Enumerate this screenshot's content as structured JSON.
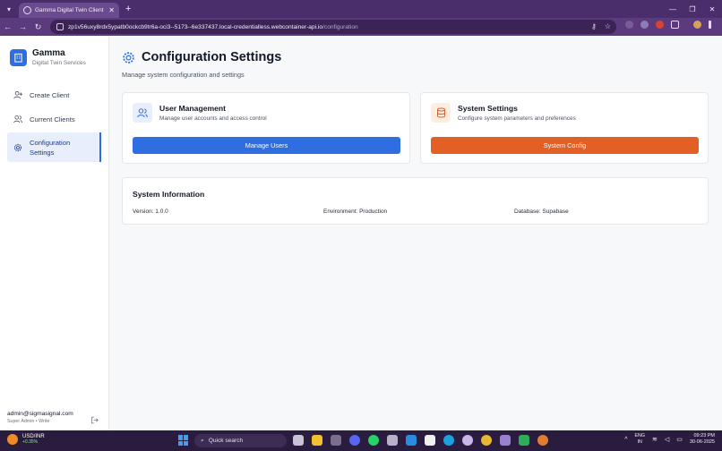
{
  "browser": {
    "tab_title": "Gamma Digital Twin Client Ord",
    "new_tab": "+",
    "url_host": "zp1v56uxy8rdx5ypatb0ockcb9tr6a-oci3--5173--6e337437.local-credentialless.webcontainer-api.io",
    "url_path": "/configuration"
  },
  "sidebar": {
    "brand_name": "Gamma",
    "brand_sub": "Digital Twin Services",
    "items": [
      {
        "label": "Create Client",
        "icon": "user-plus-icon"
      },
      {
        "label": "Current Clients",
        "icon": "users-icon"
      },
      {
        "label": "Configuration Settings",
        "icon": "gear-icon",
        "active": true
      }
    ],
    "user_email": "admin@sigmasignal.com",
    "user_role": "Super Admin • Write"
  },
  "page": {
    "title": "Configuration Settings",
    "subtitle": "Manage system configuration and settings"
  },
  "cards": [
    {
      "title": "User Management",
      "desc": "Manage user accounts and access control",
      "button": "Manage Users",
      "color": "#2f6ee0",
      "icon": "users-icon"
    },
    {
      "title": "System Settings",
      "desc": "Configure system parameters and preferences",
      "button": "System Config",
      "color": "#e25f25",
      "icon": "database-icon"
    }
  ],
  "system_info": {
    "title": "System Information",
    "version": "Version: 1.0.0",
    "environment": "Environment: Production",
    "database": "Database: Supabase"
  },
  "taskbar": {
    "ticker": "USD/INR",
    "ticker_change": "+0.35%",
    "search": "Quick search",
    "lang1": "ENG",
    "lang2": "IN",
    "time": "09:23 PM",
    "date": "30-06-2025"
  }
}
